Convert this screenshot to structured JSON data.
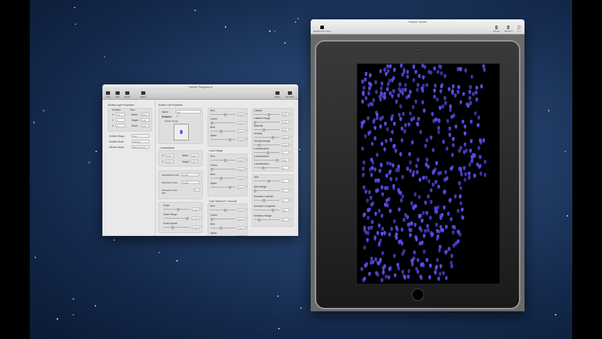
{
  "playground": {
    "title": "Particle Playground",
    "toolbar_left": [
      "Load",
      "Save",
      "Export",
      "Object"
    ],
    "toolbar_right": [
      "Reset",
      "Simulator"
    ],
    "emitter_header": "Emitter Layer Properties",
    "position_label": "Position",
    "size_label": "Size",
    "pos": [
      {
        "axis": "X",
        "value": "0.0"
      },
      {
        "axis": "Y",
        "value": "0"
      },
      {
        "axis": "Z",
        "value": "0"
      }
    ],
    "size": [
      {
        "label": "Width",
        "value": "512.0"
      },
      {
        "label": "Height",
        "value": "1.00"
      },
      {
        "label": "Depth",
        "value": "0.00"
      }
    ],
    "emitter_rows": [
      {
        "label": "Emitter Shape",
        "value": "Line"
      },
      {
        "label": "Emitter Mode",
        "value": "Volume"
      },
      {
        "label": "Render Mode",
        "value": "Back To Front"
      }
    ],
    "cell_header": "Emitter Cell Properties",
    "name_label": "Name",
    "name_value": "cell",
    "enabled_label": "Enabled",
    "particle_image_label": "Particle Image",
    "contents_rect_label": "ContentsRect",
    "rect": [
      {
        "label": "X",
        "value": "0.00"
      },
      {
        "label": "Width",
        "value": "1.00"
      },
      {
        "label": "Y",
        "value": "0.00"
      },
      {
        "label": "Height",
        "value": "1.00"
      }
    ],
    "filters": [
      {
        "label": "Magnification Filter",
        "value": "Linear"
      },
      {
        "label": "Minification Filter",
        "value": "Linear"
      },
      {
        "label": "Minification Filter Bias",
        "value": "0"
      }
    ],
    "scale": [
      {
        "label": "Scale",
        "value": "1.00"
      },
      {
        "label": "Scale Range",
        "value": "0.10"
      },
      {
        "label": "Scale Speed",
        "value": "0.10"
      }
    ],
    "color": [
      {
        "label": "Red",
        "value": "0.50"
      },
      {
        "label": "Green",
        "value": "0.50"
      },
      {
        "label": "Blue",
        "value": "1.00"
      },
      {
        "label": "Alpha",
        "value": "1.00"
      }
    ],
    "color_range_header": "Color Range",
    "color_range": [
      {
        "label": "Red",
        "value": "0.00"
      },
      {
        "label": "Green",
        "value": "0.00"
      },
      {
        "label": "Blue",
        "value": "0.00"
      },
      {
        "label": "Alpha",
        "value": "1.00"
      }
    ],
    "color_speed_header": "Color Speed (% / second)",
    "color_speed": [
      {
        "label": "Red",
        "value": "0.00"
      },
      {
        "label": "Green",
        "value": "0.00"
      },
      {
        "label": "Blue",
        "value": "0.00"
      },
      {
        "label": "Alpha",
        "value": "-0.10"
      }
    ],
    "motion": [
      {
        "label": "Lifetime",
        "value": "5.00"
      },
      {
        "label": "Lifetime Range",
        "value": "0.00"
      },
      {
        "label": "Birthrate",
        "value": "400"
      },
      {
        "label": "Velocity",
        "value": "400.0"
      },
      {
        "label": "Velocity Range",
        "value": "100.0"
      },
      {
        "label": "x Acceleration",
        "value": "0"
      },
      {
        "label": "y Acceleration",
        "value": "100"
      },
      {
        "label": "z Acceleration",
        "value": "0"
      }
    ],
    "spin": [
      {
        "label": "Spin",
        "value": "0"
      },
      {
        "label": "Spin Range",
        "value": "0"
      },
      {
        "label": "Emission Latitude",
        "value": "0"
      },
      {
        "label": "Emission Longitude",
        "value": "90"
      },
      {
        "label": "Emission Range",
        "value": "0"
      }
    ]
  },
  "simulator": {
    "title": "Particle Viewer",
    "bg_label": "Background Colour",
    "devices": [
      "iPhone",
      "iPhone 5",
      "iPad"
    ]
  },
  "colors": {
    "particle": "#5a4ff0"
  }
}
